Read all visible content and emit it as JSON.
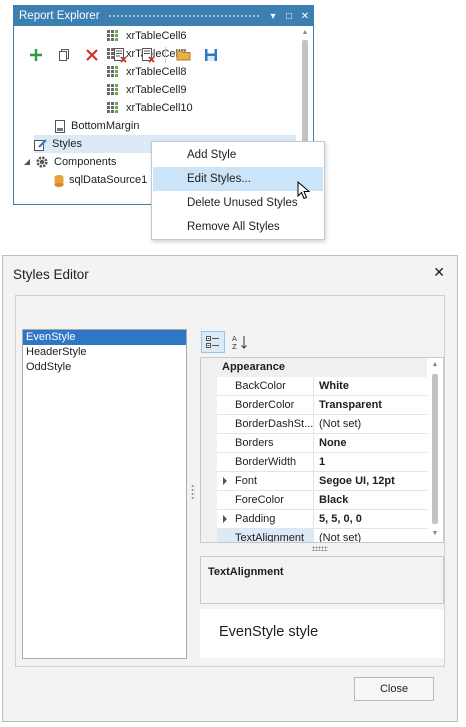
{
  "report_explorer": {
    "title": "Report Explorer",
    "title_buttons": {
      "dropdown": "▾",
      "restore": "□",
      "close": "✕"
    },
    "tree": [
      {
        "label": "xrTableCell6"
      },
      {
        "label": "xrTableCell7"
      },
      {
        "label": "xrTableCell8"
      },
      {
        "label": "xrTableCell9"
      },
      {
        "label": "xrTableCell10"
      },
      {
        "label": "BottomMargin"
      },
      {
        "label": "Styles"
      },
      {
        "label": "Components"
      },
      {
        "label": "sqlDataSource1"
      }
    ]
  },
  "context_menu": {
    "items": [
      {
        "label": "Add Style"
      },
      {
        "label": "Edit Styles..."
      },
      {
        "label": "Delete Unused Styles"
      },
      {
        "label": "Remove All Styles"
      }
    ],
    "highlighted_index": 1
  },
  "styles_editor": {
    "title": "Styles Editor",
    "close_glyph": "✕",
    "toolbar_icons": [
      "add-icon",
      "copy-icon",
      "delete-icon",
      "purge-icon",
      "clear-icon",
      "open-icon",
      "save-icon"
    ],
    "styles": [
      {
        "label": "EvenStyle"
      },
      {
        "label": "HeaderStyle"
      },
      {
        "label": "OddStyle"
      }
    ],
    "selected_style_index": 0,
    "property_grid": {
      "category": "Appearance",
      "rows": [
        {
          "name": "BackColor",
          "value": "White"
        },
        {
          "name": "BorderColor",
          "value": "Transparent"
        },
        {
          "name": "BorderDashSt...",
          "value": "(Not set)"
        },
        {
          "name": "Borders",
          "value": "None"
        },
        {
          "name": "BorderWidth",
          "value": "1"
        },
        {
          "name": "Font",
          "value": "Segoe UI, 12pt"
        },
        {
          "name": "ForeColor",
          "value": "Black"
        },
        {
          "name": "Padding",
          "value": "5, 5, 0, 0"
        },
        {
          "name": "TextAlignment",
          "value": "(Not set)"
        }
      ]
    },
    "description_title": "TextAlignment",
    "preview_text": "EvenStyle style",
    "close_button": "Close"
  },
  "colors": {
    "title_bar": "#3c7fb1",
    "selection": "#2f77c4",
    "menu_highlight": "#cce4f7"
  }
}
